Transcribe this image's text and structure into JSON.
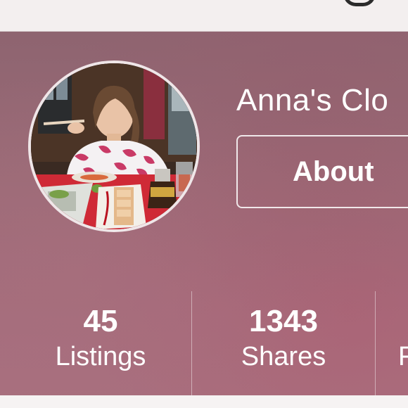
{
  "profile": {
    "title": "Anna's Clo",
    "about_label": "About"
  },
  "stats": [
    {
      "value": "45",
      "label": "Listings"
    },
    {
      "value": "1343",
      "label": "Shares"
    },
    {
      "value": "",
      "label": "F"
    }
  ],
  "colors": {
    "header_tint": "#9a6b77",
    "text": "#ffffff",
    "top_bar": "#f3efef"
  }
}
